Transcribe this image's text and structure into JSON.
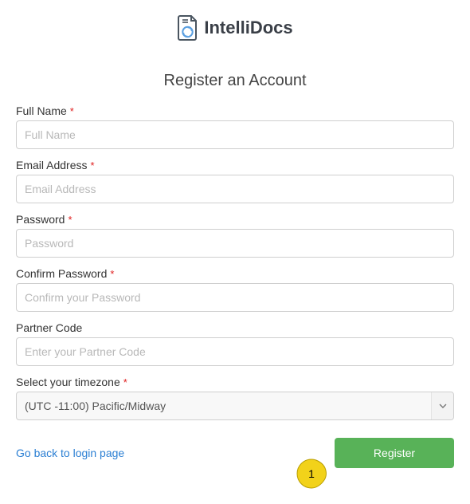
{
  "brand": {
    "name": "IntelliDocs"
  },
  "title": "Register an Account",
  "fields": [
    {
      "label": "Full Name",
      "required": true,
      "placeholder": "Full Name",
      "value": "",
      "type": "text",
      "name": "full-name-field"
    },
    {
      "label": "Email Address",
      "required": true,
      "placeholder": "Email Address",
      "value": "",
      "type": "email",
      "name": "email-field"
    },
    {
      "label": "Password",
      "required": true,
      "placeholder": "Password",
      "value": "",
      "type": "password",
      "name": "password-field"
    },
    {
      "label": "Confirm Password",
      "required": true,
      "placeholder": "Confirm your Password",
      "value": "",
      "type": "password",
      "name": "confirm-password-field"
    },
    {
      "label": "Partner Code",
      "required": false,
      "placeholder": "Enter your Partner Code",
      "value": "",
      "type": "text",
      "name": "partner-code-field"
    }
  ],
  "timezone": {
    "label": "Select your timezone",
    "required": true,
    "selected": "(UTC -11:00) Pacific/Midway"
  },
  "actions": {
    "back_link": "Go back to login page",
    "register_label": "Register"
  },
  "required_marker": "*",
  "callout": {
    "number": "1"
  },
  "colors": {
    "accent": "#58b258",
    "link": "#2b7fd3",
    "required": "#e02020"
  }
}
